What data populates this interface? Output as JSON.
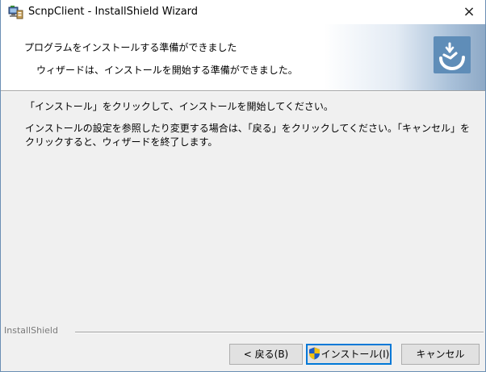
{
  "window": {
    "title": "ScnpClient - InstallShield Wizard",
    "close_symbol": "×",
    "icon": "installer-computer-icon"
  },
  "header": {
    "title": "プログラムをインストールする準備ができました",
    "subtitle": "ウィザードは、インストールを開始する準備ができました。",
    "logo_icon": "installshield-logo-icon"
  },
  "body": {
    "paragraph1": "「インストール」をクリックして、インストールを開始してください。",
    "paragraph2": "インストールの設定を参照したり変更する場合は、「戻る」をクリックしてください。「キャンセル」をクリックすると、ウィザードを終了します。"
  },
  "footer": {
    "brand": "InstallShield"
  },
  "buttons": {
    "back": "< 戻る(B)",
    "install": "インストール(I)",
    "install_icon": "uac-shield-icon",
    "cancel": "キャンセル"
  },
  "colors": {
    "accent": "#0078d7",
    "logo": "#5f8db8",
    "dialog_bg": "#f0f0f0"
  }
}
